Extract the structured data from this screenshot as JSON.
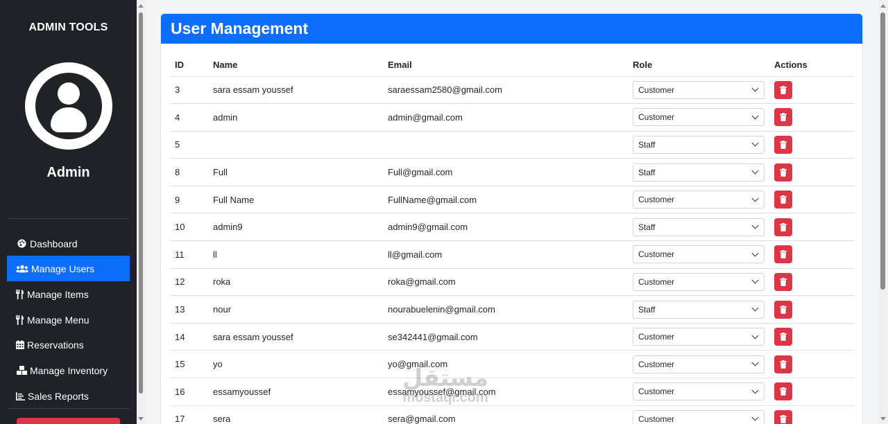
{
  "sidebar": {
    "title": "ADMIN TOOLS",
    "user_name": "Admin",
    "items": [
      {
        "label": "Dashboard",
        "icon": "palette-icon",
        "active": false
      },
      {
        "label": "Manage Users",
        "icon": "users-icon",
        "active": true
      },
      {
        "label": "Manage Items",
        "icon": "utensils-icon",
        "active": false
      },
      {
        "label": "Manage Menu",
        "icon": "utensils-icon",
        "active": false
      },
      {
        "label": "Reservations",
        "icon": "calendar-icon",
        "active": false
      },
      {
        "label": "Manage Inventory",
        "icon": "boxes-icon",
        "active": false
      },
      {
        "label": "Sales Reports",
        "icon": "chart-icon",
        "active": false
      }
    ]
  },
  "main": {
    "title": "User Management",
    "columns": [
      "ID",
      "Name",
      "Email",
      "Role",
      "Actions"
    ],
    "users": [
      {
        "id": "3",
        "name": "sara essam youssef",
        "email": "saraessam2580@gmail.com",
        "role": "Customer"
      },
      {
        "id": "4",
        "name": "admin",
        "email": "admin@gmail.com",
        "role": "Customer"
      },
      {
        "id": "5",
        "name": "",
        "email": "",
        "role": "Staff"
      },
      {
        "id": "8",
        "name": "Full",
        "email": "Full@gmail.com",
        "role": "Staff"
      },
      {
        "id": "9",
        "name": "Full Name",
        "email": "FullName@gmail.com",
        "role": "Customer"
      },
      {
        "id": "10",
        "name": "admin9",
        "email": "admin9@gmail.com",
        "role": "Staff"
      },
      {
        "id": "11",
        "name": "ll",
        "email": "ll@gmail.com",
        "role": "Customer"
      },
      {
        "id": "12",
        "name": "roka",
        "email": "roka@gmail.com",
        "role": "Customer"
      },
      {
        "id": "13",
        "name": "nour",
        "email": "nourabuelenin@gmail.com",
        "role": "Staff"
      },
      {
        "id": "14",
        "name": "sara essam youssef",
        "email": "se342441@gmail.com",
        "role": "Customer"
      },
      {
        "id": "15",
        "name": "yo",
        "email": "yo@gmail.com",
        "role": "Customer"
      },
      {
        "id": "16",
        "name": "essamyoussef",
        "email": "essamyoussef@gmail.com",
        "role": "Customer"
      },
      {
        "id": "17",
        "name": "sera",
        "email": "sera@gmail.com",
        "role": "Customer"
      }
    ]
  },
  "watermark": {
    "arabic": "مستقل",
    "latin": "mostaql.com"
  },
  "colors": {
    "accent": "#0d6efd",
    "danger": "#dc3545",
    "sidebar_bg": "#1f2226"
  }
}
